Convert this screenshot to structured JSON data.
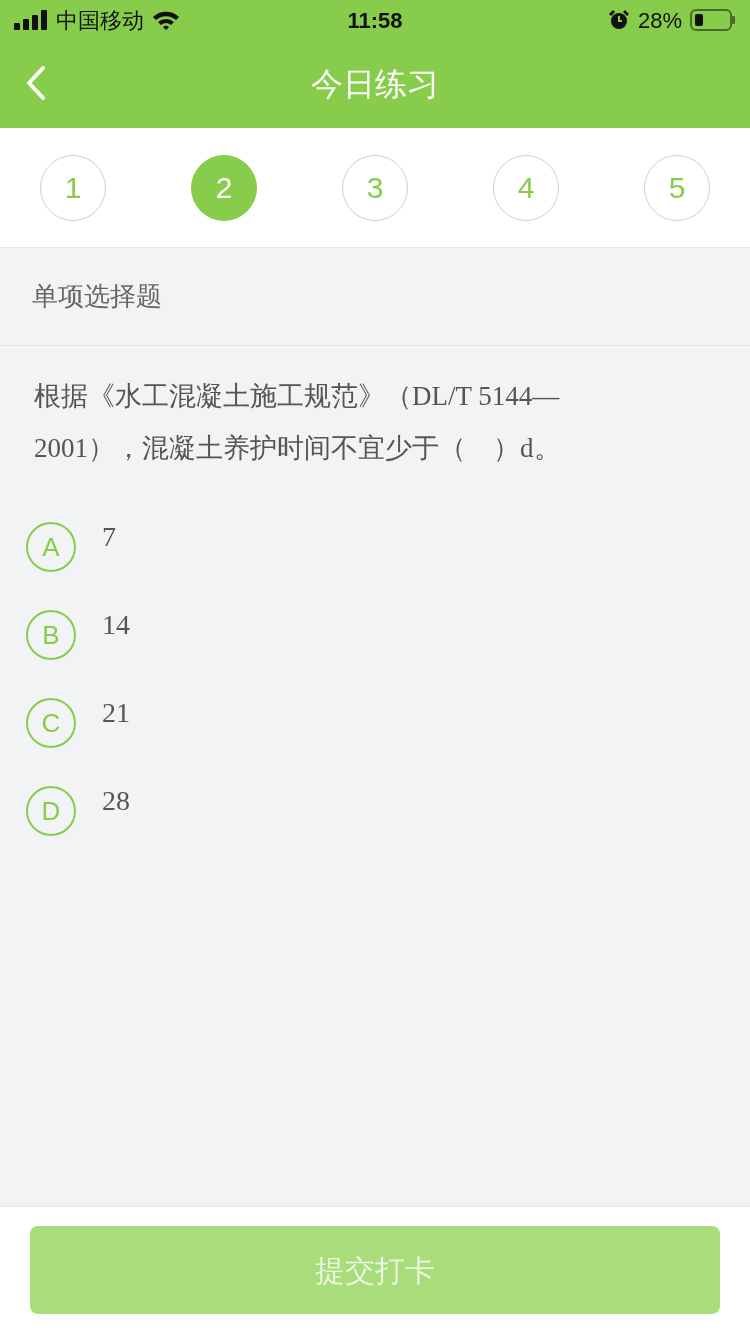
{
  "status_bar": {
    "carrier": "中国移动",
    "time": "11:58",
    "battery": "28%"
  },
  "nav": {
    "title": "今日练习"
  },
  "questions": [
    {
      "label": "1",
      "selected": false
    },
    {
      "label": "2",
      "selected": true
    },
    {
      "label": "3",
      "selected": false
    },
    {
      "label": "4",
      "selected": false
    },
    {
      "label": "5",
      "selected": false
    }
  ],
  "section": {
    "title": "单项选择题"
  },
  "question": {
    "text": "根据《水工混凝土施工规范》（DL/T 5144—2001），混凝土养护时间不宜少于（　）d。"
  },
  "options": [
    {
      "letter": "A",
      "text": "7",
      "selected": false
    },
    {
      "letter": "B",
      "text": "14",
      "selected": false
    },
    {
      "letter": "C",
      "text": "21",
      "selected": false
    },
    {
      "letter": "D",
      "text": "28",
      "selected": false
    }
  ],
  "submit": {
    "label": "提交打卡",
    "disabled": true
  }
}
